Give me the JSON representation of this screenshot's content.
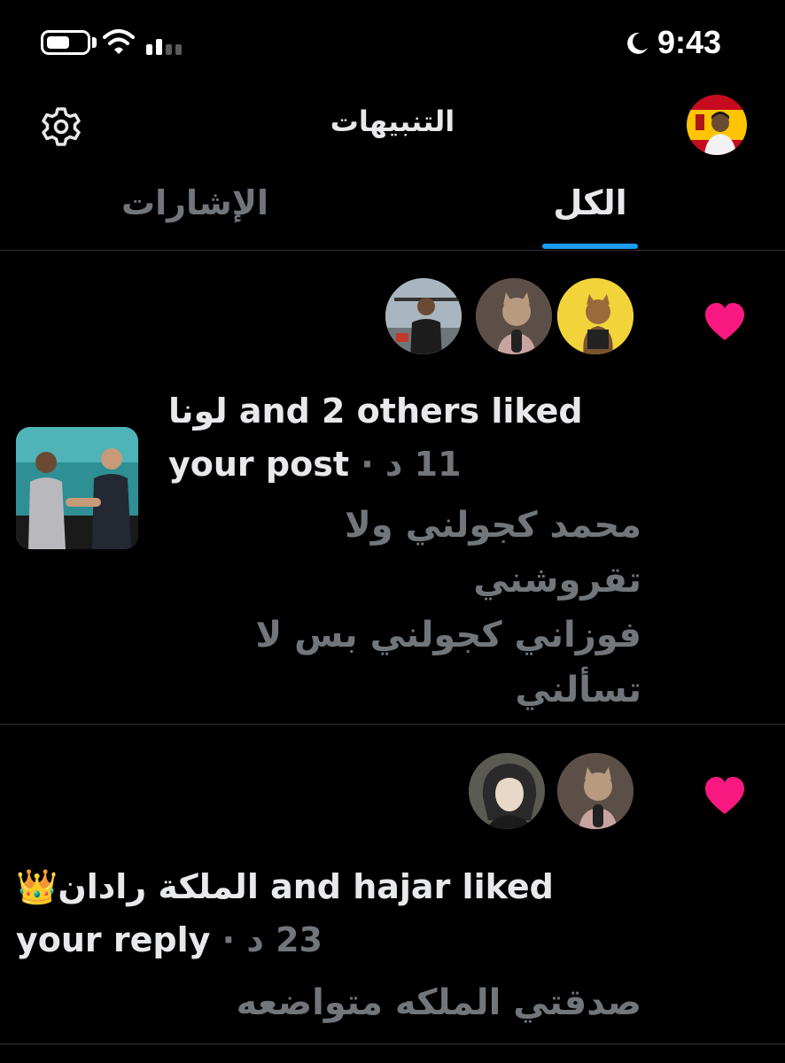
{
  "status_bar": {
    "time": "9:43",
    "battery_level": 0.6,
    "icons": [
      "battery-icon",
      "wifi-icon",
      "cellular-signal-icon",
      "moon-icon"
    ]
  },
  "header": {
    "title": "التنبيهات",
    "settings_icon": "gear-icon",
    "profile_avatar": "profile-avatar"
  },
  "tabs": [
    {
      "label": "الكل",
      "active": true
    },
    {
      "label": "الإشارات",
      "active": false
    }
  ],
  "notifications": [
    {
      "type": "like",
      "icon": "heart-icon",
      "actor_name": "لونا",
      "action_text": "and 2 others liked",
      "object_text": "your post",
      "separator": "·",
      "time": "11 د",
      "snippet_lines": [
        "محمد كجولني ولا",
        "تقروشني",
        "فوزاني كجولني بس لا",
        "تسألني"
      ]
    },
    {
      "type": "like",
      "icon": "heart-icon",
      "actor_name": "الملكة رادان",
      "actor_emoji": "👑",
      "action_text": "and hajar liked",
      "object_text": "your reply",
      "separator": "·",
      "time": "23 د",
      "snippet_lines": [
        "صدقتي الملكه متواضعه"
      ]
    }
  ],
  "colors": {
    "background": "#000000",
    "text_primary": "#e7e9ea",
    "text_secondary": "#71767b",
    "accent": "#1d9bf0",
    "heart": "#f91880",
    "divider": "#2f3336"
  }
}
